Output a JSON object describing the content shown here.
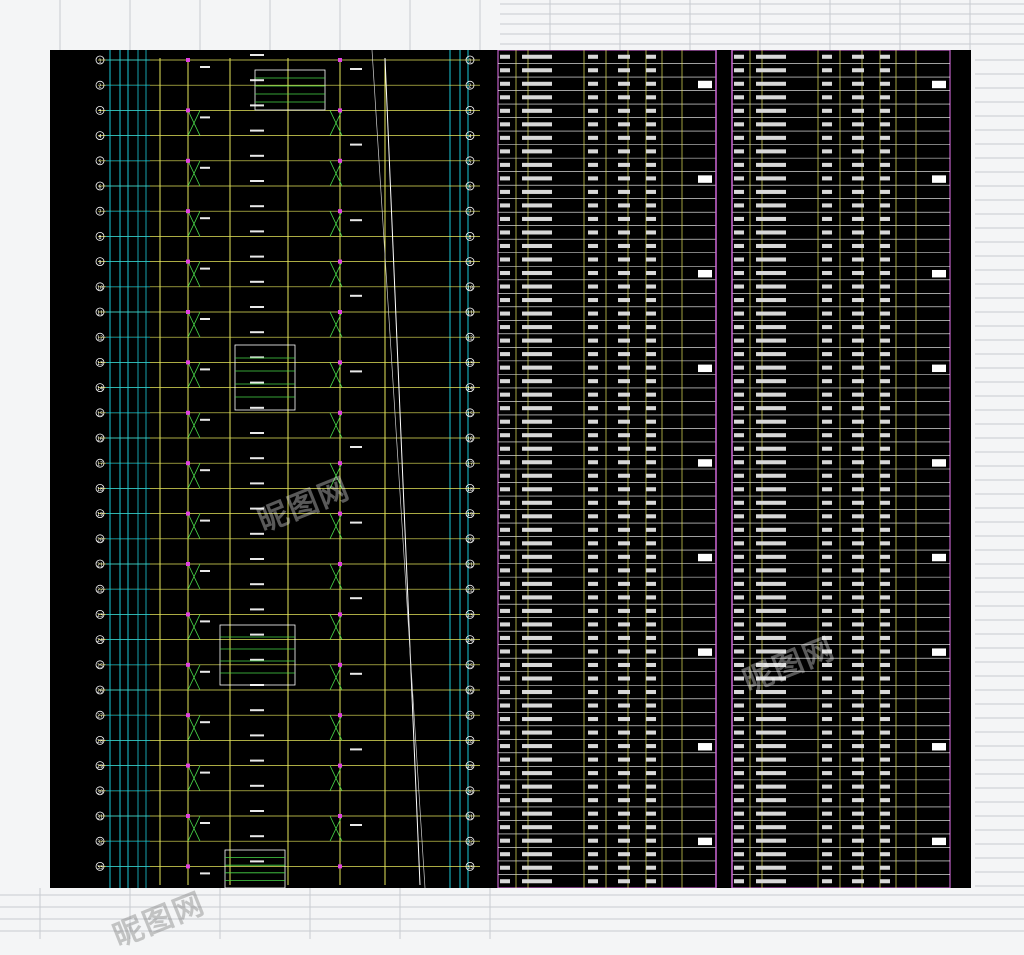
{
  "drawing": {
    "grid_bubbles": [
      "1",
      "2",
      "3",
      "4",
      "5",
      "6",
      "7",
      "8",
      "9",
      "10",
      "11",
      "12",
      "13",
      "14",
      "15",
      "16",
      "17",
      "18",
      "19",
      "20",
      "21",
      "22",
      "23",
      "24",
      "25",
      "26",
      "27",
      "28",
      "29",
      "30",
      "31",
      "32",
      "33"
    ],
    "colors": {
      "background": "#000000",
      "grid_line": "#19c8d8",
      "beam_line": "#e6e65a",
      "green_line": "#48d848",
      "text": "#f0f0f0",
      "table_border": "#c060c8",
      "accent": "#ff6060"
    }
  },
  "tables": {
    "schedule_a": {
      "rows": 62,
      "columns": 9
    },
    "schedule_b": {
      "rows": 62,
      "columns": 9
    }
  },
  "watermark": {
    "text": "昵图网"
  }
}
